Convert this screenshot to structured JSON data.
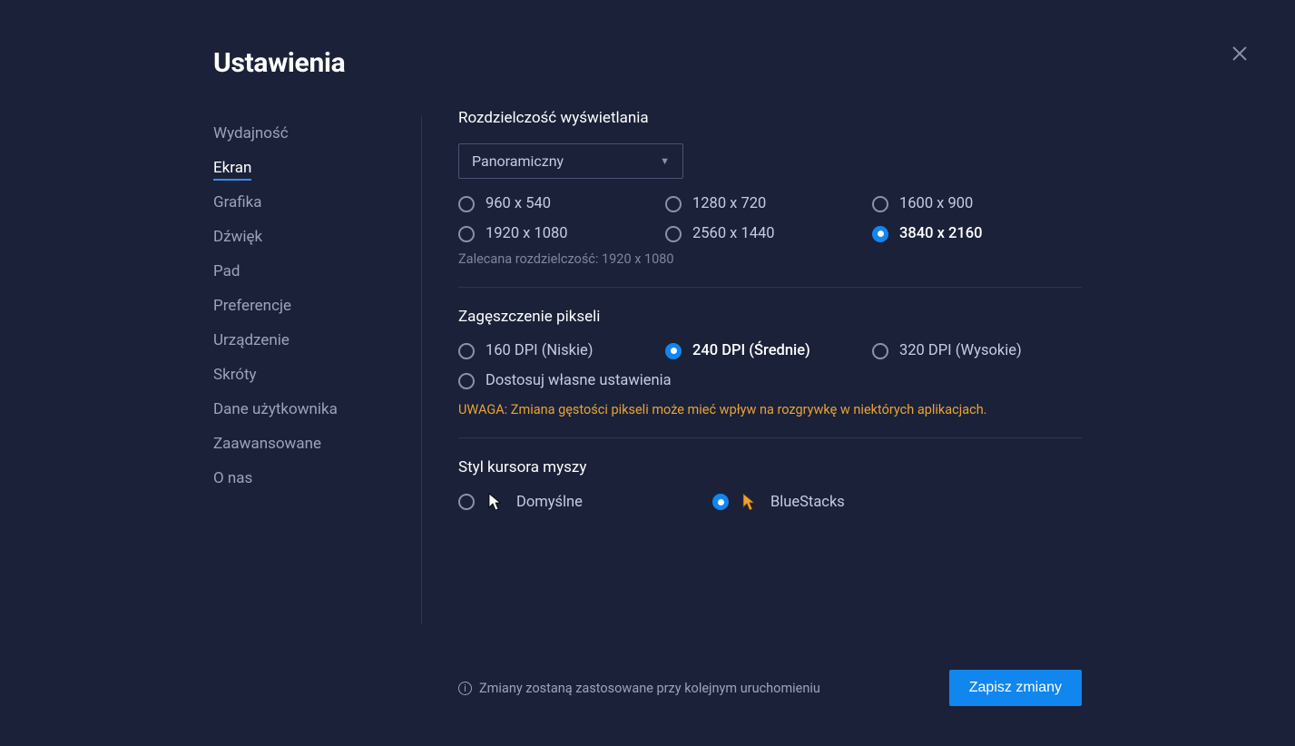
{
  "title": "Ustawienia",
  "sidebar": {
    "items": [
      {
        "label": "Wydajność",
        "active": false
      },
      {
        "label": "Ekran",
        "active": true
      },
      {
        "label": "Grafika",
        "active": false
      },
      {
        "label": "Dźwięk",
        "active": false
      },
      {
        "label": "Pad",
        "active": false
      },
      {
        "label": "Preferencje",
        "active": false
      },
      {
        "label": "Urządzenie",
        "active": false
      },
      {
        "label": "Skróty",
        "active": false
      },
      {
        "label": "Dane użytkownika",
        "active": false
      },
      {
        "label": "Zaawansowane",
        "active": false
      },
      {
        "label": "O nas",
        "active": false
      }
    ]
  },
  "resolution": {
    "title": "Rozdzielczość wyświetlania",
    "aspect_selected": "Panoramiczny",
    "options": [
      {
        "label": "960 x 540",
        "selected": false
      },
      {
        "label": "1280 x 720",
        "selected": false
      },
      {
        "label": "1600 x 900",
        "selected": false
      },
      {
        "label": "1920 x 1080",
        "selected": false
      },
      {
        "label": "2560 x 1440",
        "selected": false
      },
      {
        "label": "3840 x 2160",
        "selected": true
      }
    ],
    "recommended": "Zalecana rozdzielczość: 1920 x 1080"
  },
  "dpi": {
    "title": "Zagęszczenie pikseli",
    "options": [
      {
        "label": "160 DPI (Niskie)",
        "selected": false
      },
      {
        "label": "240 DPI (Średnie)",
        "selected": true
      },
      {
        "label": "320 DPI (Wysokie)",
        "selected": false
      }
    ],
    "custom_label": "Dostosuj własne ustawienia",
    "warning": "UWAGA: Zmiana gęstości pikseli może mieć wpływ na rozgrywkę w niektórych aplikacjach."
  },
  "cursor": {
    "title": "Styl kursora myszy",
    "options": [
      {
        "label": "Domyślne",
        "selected": false
      },
      {
        "label": "BlueStacks",
        "selected": true
      }
    ]
  },
  "footer": {
    "note": "Zmiany zostaną zastosowane przy kolejnym uruchomieniu",
    "save": "Zapisz zmiany"
  }
}
